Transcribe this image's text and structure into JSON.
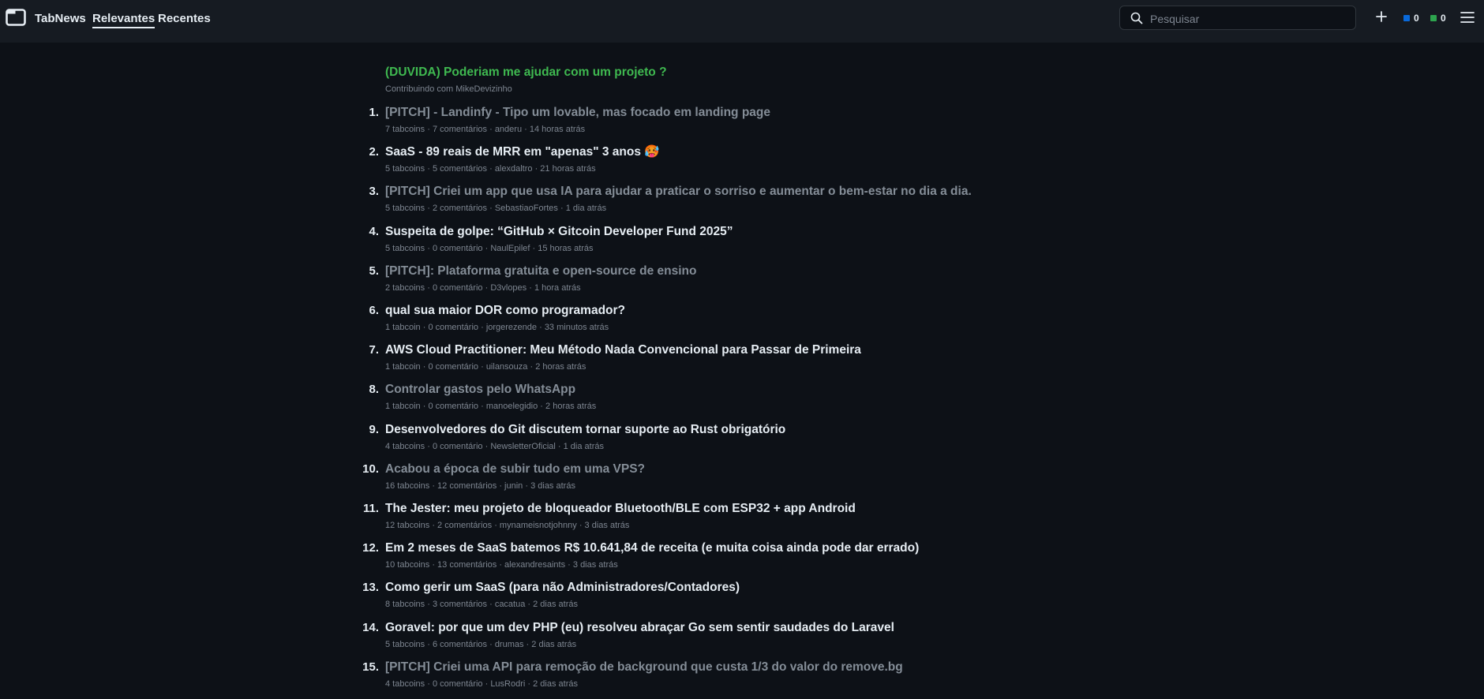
{
  "app": {
    "brand": "TabNews",
    "accent_green": "#3fb950",
    "coin_blue": "#0969da",
    "coin_green": "#2da44e"
  },
  "nav": {
    "tabs": [
      {
        "label": "Relevantes",
        "active": true
      },
      {
        "label": "Recentes",
        "active": false
      }
    ]
  },
  "search": {
    "placeholder": "Pesquisar",
    "value": ""
  },
  "user": {
    "tabcoins": "0",
    "tabcash": "0"
  },
  "icons": {
    "logo": "tabnews-logo-icon",
    "search": "search-icon",
    "add": "plus-icon",
    "menu": "hamburger-menu-icon"
  },
  "promo": {
    "title": "(DUVIDA) Poderiam me ajudar com um projeto ?",
    "meta": "Contribuindo com MikeDevizinho"
  },
  "posts": [
    {
      "num": "1.",
      "title": "[PITCH] - Landinfy - Tipo um lovable, mas focado em landing page",
      "visited": true,
      "tabcoins": "7 tabcoins",
      "comments": "7 comentários",
      "author": "anderu",
      "time": "14 horas atrás"
    },
    {
      "num": "2.",
      "title": "SaaS - 89 reais de MRR em \"apenas\" 3 anos 🥵",
      "visited": false,
      "tabcoins": "5 tabcoins",
      "comments": "5 comentários",
      "author": "alexdaltro",
      "time": "21 horas atrás"
    },
    {
      "num": "3.",
      "title": "[PITCH] Criei um app que usa IA para ajudar a praticar o sorriso e aumentar o bem-estar no dia a dia.",
      "visited": true,
      "tabcoins": "5 tabcoins",
      "comments": "2 comentários",
      "author": "SebastiaoFortes",
      "time": "1 dia atrás"
    },
    {
      "num": "4.",
      "title": "Suspeita de golpe: “GitHub × Gitcoin Developer Fund 2025”",
      "visited": false,
      "tabcoins": "5 tabcoins",
      "comments": "0 comentário",
      "author": "NaulEpilef",
      "time": "15 horas atrás"
    },
    {
      "num": "5.",
      "title": "[PITCH]: Plataforma gratuita e open-source de ensino",
      "visited": true,
      "tabcoins": "2 tabcoins",
      "comments": "0 comentário",
      "author": "D3vlopes",
      "time": "1 hora atrás"
    },
    {
      "num": "6.",
      "title": "qual sua maior DOR como programador?",
      "visited": false,
      "tabcoins": "1 tabcoin",
      "comments": "0 comentário",
      "author": "jorgerezende",
      "time": "33 minutos atrás"
    },
    {
      "num": "7.",
      "title": "AWS Cloud Practitioner: Meu Método Nada Convencional para Passar de Primeira",
      "visited": false,
      "tabcoins": "1 tabcoin",
      "comments": "0 comentário",
      "author": "uilansouza",
      "time": "2 horas atrás"
    },
    {
      "num": "8.",
      "title": "Controlar gastos pelo WhatsApp",
      "visited": true,
      "tabcoins": "1 tabcoin",
      "comments": "0 comentário",
      "author": "manoelegidio",
      "time": "2 horas atrás"
    },
    {
      "num": "9.",
      "title": "Desenvolvedores do Git discutem tornar suporte ao Rust obrigatório",
      "visited": false,
      "tabcoins": "4 tabcoins",
      "comments": "0 comentário",
      "author": "NewsletterOficial",
      "time": "1 dia atrás"
    },
    {
      "num": "10.",
      "title": "Acabou a época de subir tudo em uma VPS?",
      "visited": true,
      "tabcoins": "16 tabcoins",
      "comments": "12 comentários",
      "author": "junin",
      "time": "3 dias atrás"
    },
    {
      "num": "11.",
      "title": "The Jester: meu projeto de bloqueador Bluetooth/BLE com ESP32 + app Android",
      "visited": false,
      "tabcoins": "12 tabcoins",
      "comments": "2 comentários",
      "author": "mynameisnotjohnny",
      "time": "3 dias atrás"
    },
    {
      "num": "12.",
      "title": "Em 2 meses de SaaS batemos R$ 10.641,84 de receita (e muita coisa ainda pode dar errado)",
      "visited": false,
      "tabcoins": "10 tabcoins",
      "comments": "13 comentários",
      "author": "alexandresaints",
      "time": "3 dias atrás"
    },
    {
      "num": "13.",
      "title": "Como gerir um SaaS (para não Administradores/Contadores)",
      "visited": false,
      "tabcoins": "8 tabcoins",
      "comments": "3 comentários",
      "author": "cacatua",
      "time": "2 dias atrás"
    },
    {
      "num": "14.",
      "title": "Goravel: por que um dev PHP (eu) resolveu abraçar Go sem sentir saudades do Laravel",
      "visited": false,
      "tabcoins": "5 tabcoins",
      "comments": "6 comentários",
      "author": "drumas",
      "time": "2 dias atrás"
    },
    {
      "num": "15.",
      "title": "[PITCH] Criei uma API para remoção de background que custa 1/3 do valor do remove.bg",
      "visited": true,
      "tabcoins": "4 tabcoins",
      "comments": "0 comentário",
      "author": "LusRodri",
      "time": "2 dias atrás"
    }
  ]
}
